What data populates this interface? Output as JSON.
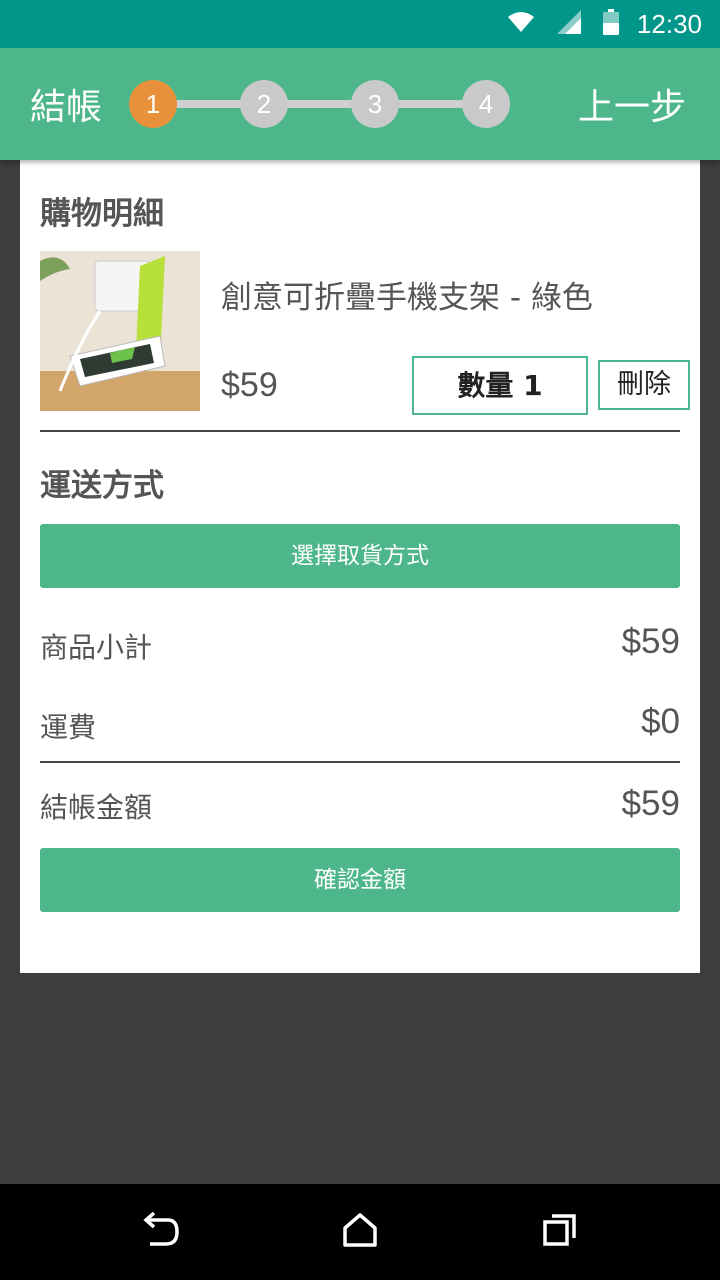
{
  "status_bar": {
    "time": "12:30",
    "icons": [
      "wifi-icon",
      "cellular-signal-icon",
      "battery-icon"
    ]
  },
  "app_bar": {
    "title": "結帳",
    "back_label": "上一步",
    "steps": [
      "1",
      "2",
      "3",
      "4"
    ],
    "active_step": 1
  },
  "cart": {
    "section_title": "購物明細",
    "item": {
      "name": "創意可折疊手機支架 - 綠色",
      "price": "$59",
      "quantity_label": "數量 1",
      "delete_label": "刪除"
    }
  },
  "shipping": {
    "section_title": "運送方式",
    "select_button": "選擇取貨方式"
  },
  "summary": {
    "subtotal_label": "商品小計",
    "subtotal_value": "$59",
    "shipping_label": "運費",
    "shipping_value": "$0",
    "total_label": "結帳金額",
    "total_value": "$59",
    "confirm_button": "確認金額"
  },
  "nav_bar": {
    "icons": [
      "back-icon",
      "home-icon",
      "recents-icon"
    ]
  },
  "colors": {
    "status_bar": "#00968a",
    "app_bar": "#4db78b",
    "active_step": "#e8913a",
    "inactive_step": "#c9c9c9",
    "background": "#3d3d3d"
  }
}
